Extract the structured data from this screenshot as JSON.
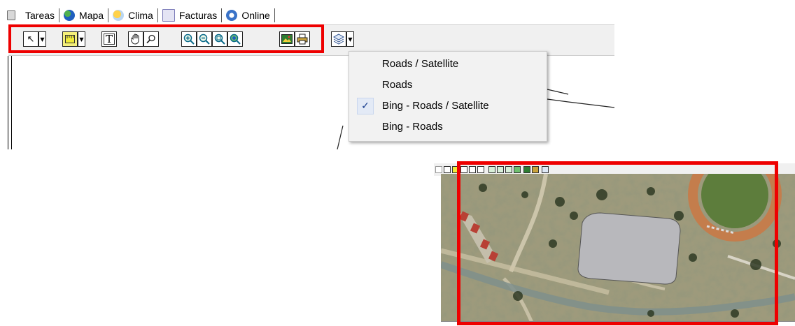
{
  "tabs": [
    {
      "label": "Tareas",
      "icon": "clipboard-icon",
      "color": "#6b6b6b"
    },
    {
      "label": "Mapa",
      "icon": "globe-icon",
      "color": "#1f5fbf"
    },
    {
      "label": "Clima",
      "icon": "weather-icon",
      "color": "#f2b400"
    },
    {
      "label": "Facturas",
      "icon": "invoice-icon",
      "color": "#7a7ab8"
    },
    {
      "label": "Online",
      "icon": "online-icon",
      "color": "#3a73c8"
    }
  ],
  "toolbar": {
    "tools": [
      {
        "name": "pointer-tool",
        "glyph": "↖"
      },
      {
        "name": "ruler-tool",
        "glyph": "▭"
      },
      {
        "name": "text-tool",
        "glyph": "T"
      },
      {
        "name": "pan-tool",
        "glyph": "✋"
      },
      {
        "name": "search-tool",
        "glyph": "🔍"
      },
      {
        "name": "zoom-in-tool",
        "glyph": "⊕"
      },
      {
        "name": "zoom-out-tool",
        "glyph": "⊖"
      },
      {
        "name": "zoom-extent-tool",
        "glyph": "◎"
      },
      {
        "name": "zoom-full-tool",
        "glyph": "◉"
      },
      {
        "name": "map-image-tool",
        "glyph": "▦"
      },
      {
        "name": "print-tool",
        "glyph": "⎙"
      },
      {
        "name": "map-layer-tool",
        "glyph": "❖"
      }
    ]
  },
  "layer_menu": {
    "items": [
      {
        "label": "Roads / Satellite",
        "checked": false
      },
      {
        "label": "Roads",
        "checked": false
      },
      {
        "label": "Bing - Roads / Satellite",
        "checked": true
      },
      {
        "label": "Bing - Roads",
        "checked": false
      }
    ],
    "check_glyph": "✓"
  },
  "colors": {
    "highlight_red": "#ee0000",
    "toolbar_bg": "#f0f0f0",
    "menu_bg": "#f2f2f2",
    "drawn_zone": "#b8b8bc"
  }
}
